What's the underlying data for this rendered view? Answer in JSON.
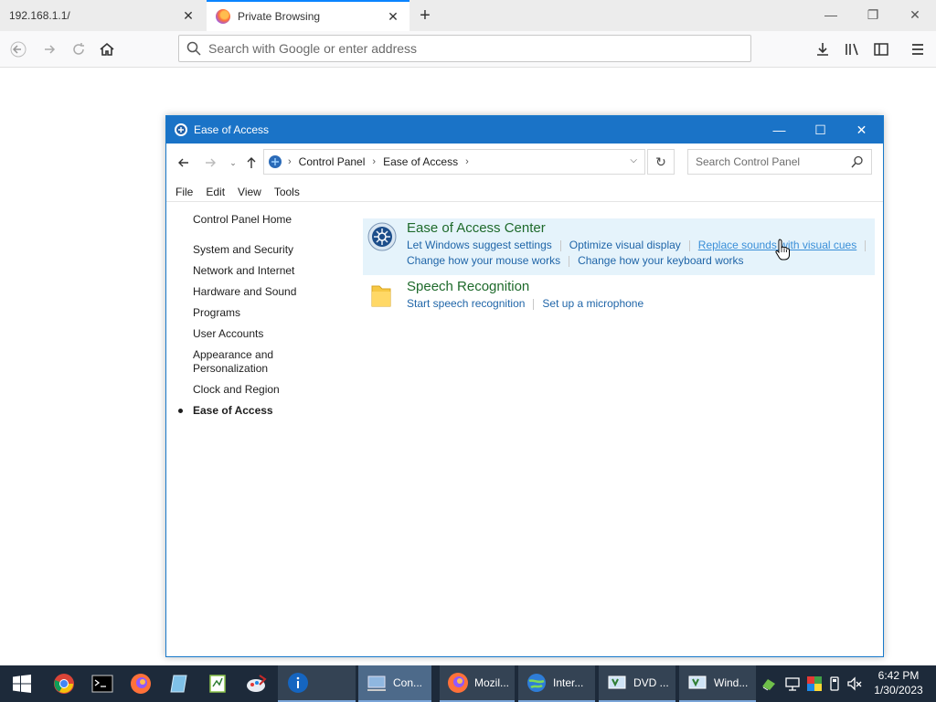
{
  "browser": {
    "tabs": [
      {
        "label": "192.168.1.1/"
      },
      {
        "label": "Private Browsing"
      }
    ],
    "address_placeholder": "Search with Google or enter address"
  },
  "window": {
    "title": "Ease of Access",
    "breadcrumb": [
      "Control Panel",
      "Ease of Access"
    ],
    "search_placeholder": "Search Control Panel",
    "menu": [
      "File",
      "Edit",
      "View",
      "Tools"
    ],
    "sidebar": {
      "home": "Control Panel Home",
      "items": [
        "System and Security",
        "Network and Internet",
        "Hardware and Sound",
        "Programs",
        "User Accounts",
        "Appearance and Personalization",
        "Clock and Region",
        "Ease of Access"
      ],
      "current": "Ease of Access"
    },
    "categories": [
      {
        "title": "Ease of Access Center",
        "links": [
          "Let Windows suggest settings",
          "Optimize visual display",
          "Replace sounds with visual cues",
          "Change how your mouse works",
          "Change how your keyboard works"
        ]
      },
      {
        "title": "Speech Recognition",
        "links": [
          "Start speech recognition",
          "Set up a microphone"
        ]
      }
    ]
  },
  "taskbar": {
    "tasks": [
      "Con...",
      "Mozil...",
      "Inter...",
      "DVD ...",
      "Wind..."
    ],
    "time": "6:42 PM",
    "date": "1/30/2023"
  },
  "colors": {
    "titlebar": "#1a73c7",
    "link": "#1f65a8",
    "category_title": "#1e6a2b",
    "highlight": "#e5f3fb",
    "taskbar": "#1d2a3a"
  }
}
